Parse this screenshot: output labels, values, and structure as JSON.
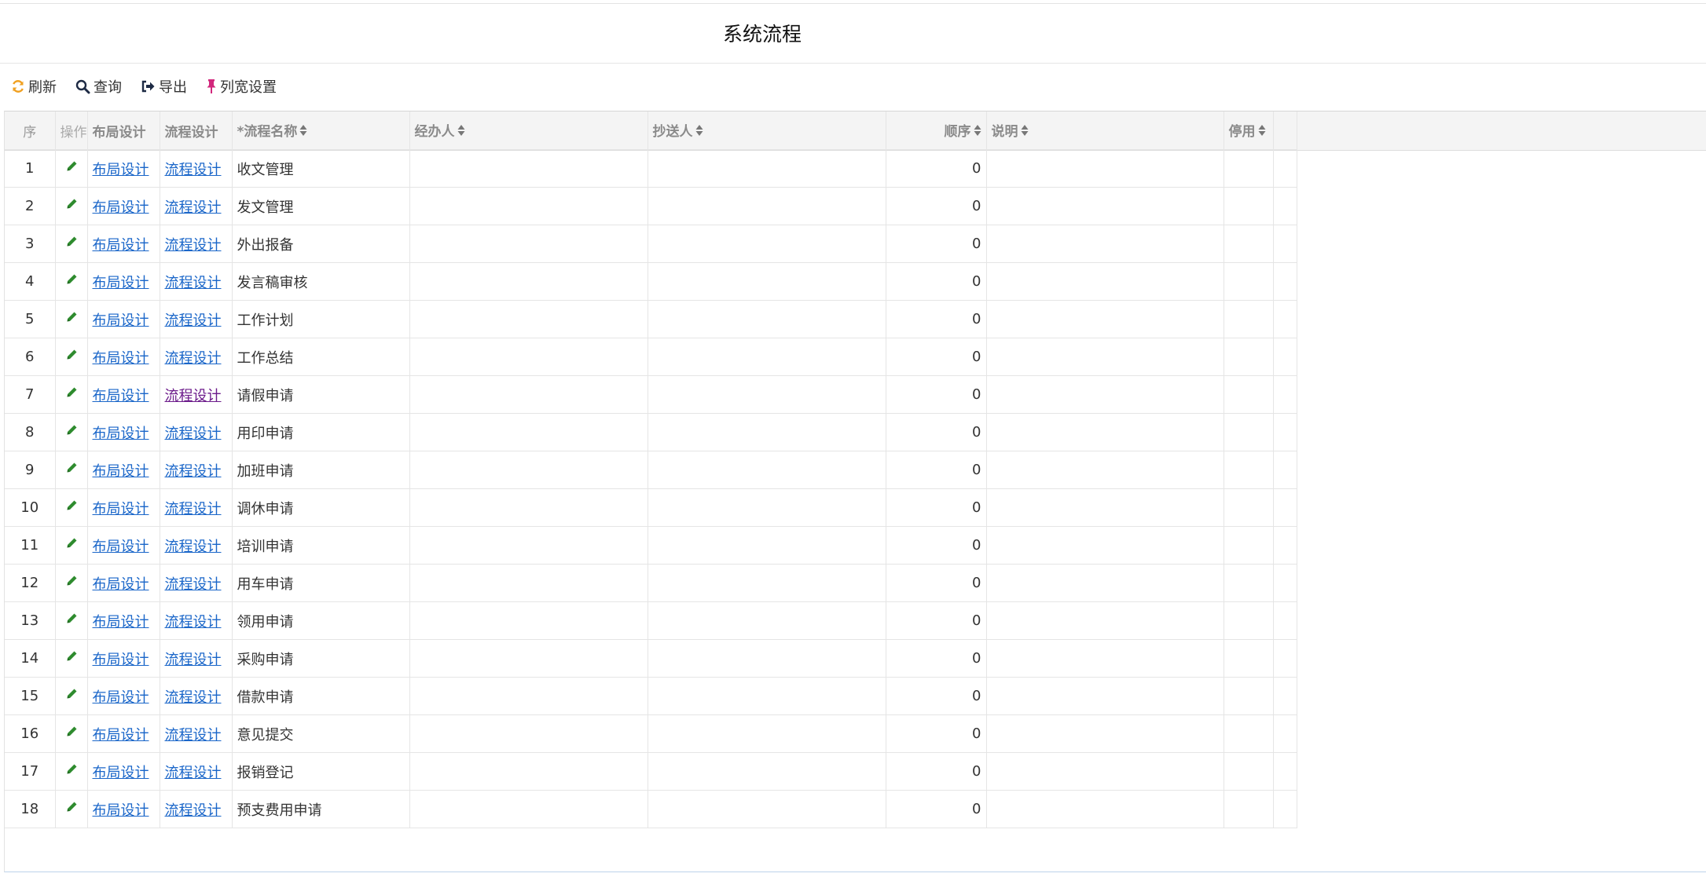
{
  "page": {
    "title": "系统流程"
  },
  "toolbar": {
    "refresh": "刷新",
    "search": "查询",
    "export": "导出",
    "column_width": "列宽设置"
  },
  "grid": {
    "columns": {
      "seq": "序",
      "op": "操作",
      "layout": "布局设计",
      "flow": "流程设计",
      "name": "*流程名称",
      "handler": "经办人",
      "cc": "抄送人",
      "order": "顺序",
      "desc": "说明",
      "disabled": "停用"
    },
    "link_layout": "布局设计",
    "link_flow": "流程设计",
    "rows": [
      {
        "seq": "1",
        "name": "收文管理",
        "order": "0"
      },
      {
        "seq": "2",
        "name": "发文管理",
        "order": "0"
      },
      {
        "seq": "3",
        "name": "外出报备",
        "order": "0"
      },
      {
        "seq": "4",
        "name": "发言稿审核",
        "order": "0"
      },
      {
        "seq": "5",
        "name": "工作计划",
        "order": "0"
      },
      {
        "seq": "6",
        "name": "工作总结",
        "order": "0"
      },
      {
        "seq": "7",
        "name": "请假申请",
        "order": "0",
        "flow_visited": true
      },
      {
        "seq": "8",
        "name": "用印申请",
        "order": "0"
      },
      {
        "seq": "9",
        "name": "加班申请",
        "order": "0"
      },
      {
        "seq": "10",
        "name": "调休申请",
        "order": "0"
      },
      {
        "seq": "11",
        "name": "培训申请",
        "order": "0"
      },
      {
        "seq": "12",
        "name": "用车申请",
        "order": "0"
      },
      {
        "seq": "13",
        "name": "领用申请",
        "order": "0"
      },
      {
        "seq": "14",
        "name": "采购申请",
        "order": "0"
      },
      {
        "seq": "15",
        "name": "借款申请",
        "order": "0"
      },
      {
        "seq": "16",
        "name": "意见提交",
        "order": "0"
      },
      {
        "seq": "17",
        "name": "报销登记",
        "order": "0"
      },
      {
        "seq": "18",
        "name": "预支费用申请",
        "order": "0"
      }
    ]
  },
  "colors": {
    "link": "#1a66c9",
    "link_visited": "#6b1a8a",
    "refresh_icon": "#f0a020",
    "pin_icon": "#d2277c",
    "edit_icon": "#2e8b2e"
  }
}
